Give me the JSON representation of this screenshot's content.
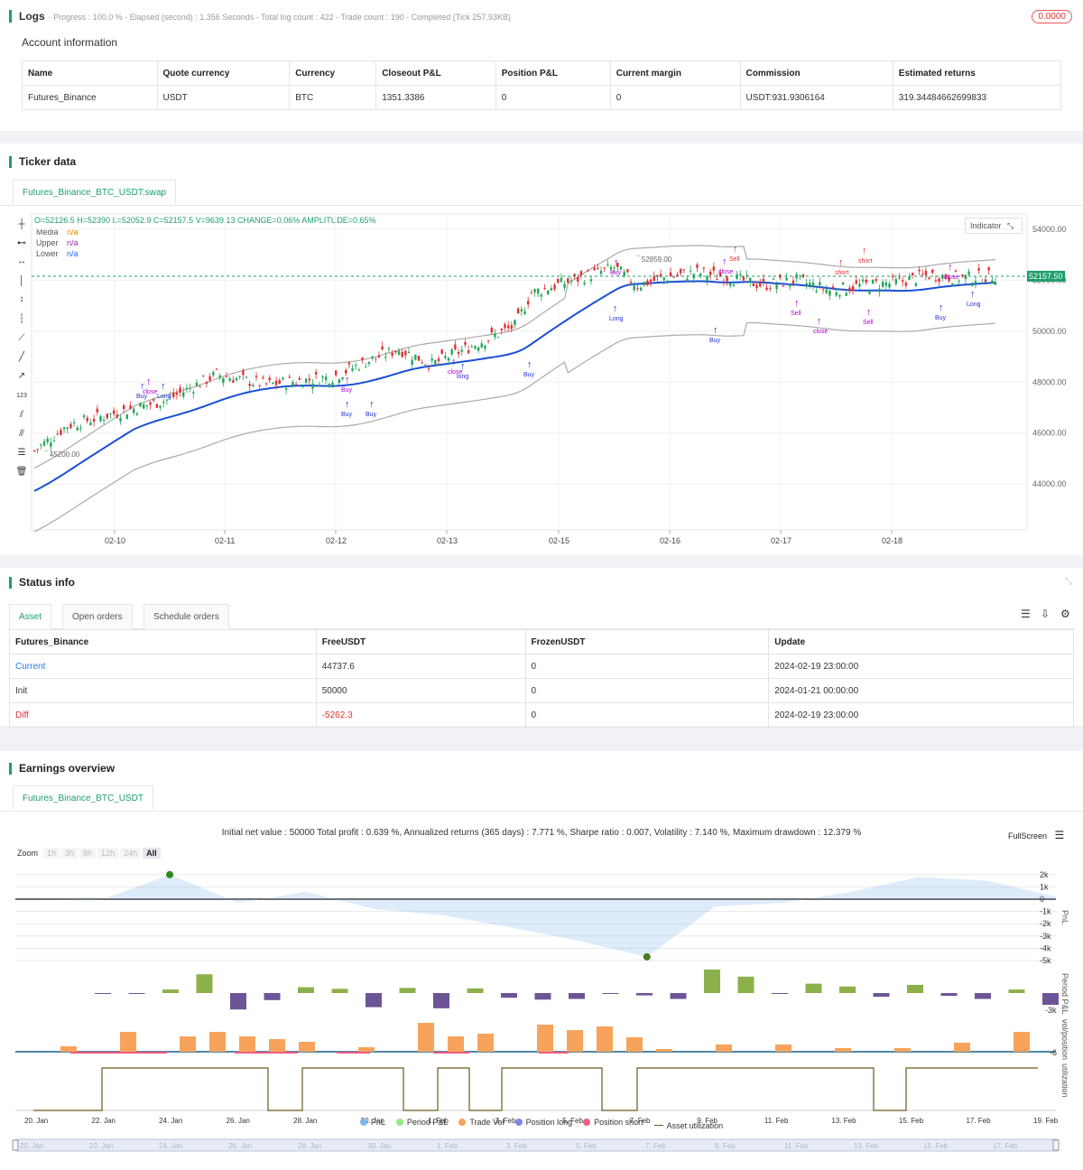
{
  "logs": {
    "title": "Logs",
    "status_line": "· Progress : 100.0 % - Elapsed (second) : 1.356  Seconds - Total log count : 422 - Trade count : 190 - Completed (Tick 257.93KB)",
    "badge": "0.0000"
  },
  "account": {
    "title": "Account information",
    "headers": [
      "Name",
      "Quote currency",
      "Currency",
      "Closeout P&L",
      "Position P&L",
      "Current margin",
      "Commission",
      "Estimated returns"
    ],
    "row": [
      "Futures_Binance",
      "USDT",
      "BTC",
      "1351.3386",
      "0",
      "0",
      "USDT:931.9306164",
      "319.34484662699833"
    ]
  },
  "ticker": {
    "title": "Ticker data",
    "tab": "Futures_Binance_BTC_USDT:swap",
    "ohlc": "O=52126.5 H=52390 L=52052.9 C=52157.5 V=9639.13 CHANGE=0.06% AMPLITUDE=0.65%",
    "indicators": [
      {
        "name": "Média",
        "value": "n/a",
        "color": "#e08a00"
      },
      {
        "name": "Upper",
        "value": "n/a",
        "color": "#9c27b0"
      },
      {
        "name": "Lower",
        "value": "n/a",
        "color": "#2962ff"
      }
    ],
    "indicator_btn": "Indicator",
    "price_tag": "52157.50",
    "hi_label": "52859.00",
    "lo_label": "45200.00",
    "y_ticks": [
      "54000.00",
      "52000.00",
      "50000.00",
      "48000.00",
      "46000.00",
      "44000.00"
    ],
    "x_ticks": [
      "02-10",
      "02-11",
      "02-12",
      "02-13",
      "02-15",
      "02-16",
      "02-17",
      "02-18"
    ]
  },
  "status": {
    "title": "Status info",
    "tabs": [
      "Asset",
      "Open orders",
      "Schedule orders"
    ],
    "headers": [
      "Futures_Binance",
      "FreeUSDT",
      "FrozenUSDT",
      "Update"
    ],
    "rows": [
      [
        "Current",
        "44737.6",
        "0",
        "2024-02-19 23:00:00"
      ],
      [
        "Init",
        "50000",
        "0",
        "2024-01-21 00:00:00"
      ],
      [
        "Diff",
        "-5262.3",
        "0",
        "2024-02-19 23:00:00"
      ]
    ]
  },
  "earnings": {
    "title": "Earnings overview",
    "tab": "Futures_Binance_BTC_USDT",
    "summary": "Initial net value : 50000 Total profit : 0.639 %, Annualized returns (365 days) : 7.771 %, Sharpe ratio : 0.007, Volatility : 7.140 %, Maximum drawdown : 12.379 %",
    "fullscreen": "FullScreen",
    "zoom_label": "Zoom",
    "zoom_opts": [
      "1h",
      "3h",
      "8h",
      "12h",
      "24h",
      "All"
    ],
    "pnl_ticks": [
      "2k",
      "1k",
      "0",
      "-1k",
      "-2k",
      "-3k",
      "-4k",
      "-5k"
    ],
    "axis_titles": [
      "PnL",
      "Period P&L",
      "vol/position",
      "utilization"
    ],
    "x_ticks": [
      "20. Jan",
      "22. Jan",
      "24. Jan",
      "26. Jan",
      "28. Jan",
      "30. Jan",
      "1. Feb",
      "3. Feb",
      "5. Feb",
      "7. Feb",
      "9. Feb",
      "11. Feb",
      "13. Feb",
      "15. Feb",
      "17. Feb",
      "19. Feb"
    ],
    "legend": [
      {
        "name": "PnL",
        "color": "#7cb5ec"
      },
      {
        "name": "Period P&L",
        "color": "#90ed7d"
      },
      {
        "name": "Trade Vol",
        "color": "#f7a35c"
      },
      {
        "name": "Position long",
        "color": "#8085e9"
      },
      {
        "name": "Position short",
        "color": "#f15c80"
      },
      {
        "name": "Asset utilization",
        "color": "#6b5a1e"
      }
    ],
    "nav_ticks": [
      "20. Jan",
      "22. Jan",
      "24. Jan",
      "26. Jan",
      "28. Jan",
      "30. Jan",
      "1. Feb",
      "3. Feb",
      "5. Feb",
      "7. Feb",
      "9. Feb",
      "11. Feb",
      "13. Feb",
      "15. Feb",
      "17. Feb"
    ]
  },
  "chart_data": {
    "type": "line",
    "title": "",
    "x": [
      "20. Jan",
      "22. Jan",
      "24. Jan",
      "26. Jan",
      "28. Jan",
      "30. Jan",
      "1. Feb",
      "3. Feb",
      "5. Feb",
      "7. Feb",
      "9. Feb",
      "11. Feb",
      "13. Feb",
      "15. Feb",
      "17. Feb",
      "19. Feb"
    ],
    "series": [
      {
        "name": "PnL",
        "values": [
          0,
          -50,
          2000,
          -300,
          600,
          -800,
          -1300,
          -2300,
          -3400,
          -4700,
          -600,
          -300,
          600,
          1800,
          1500,
          200
        ]
      }
    ],
    "ylim": [
      -5000,
      2500
    ]
  }
}
